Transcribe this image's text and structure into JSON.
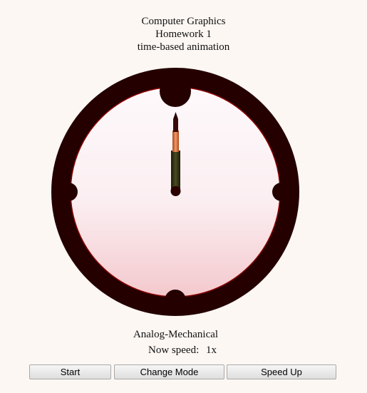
{
  "header": {
    "line1": "Computer Graphics",
    "line2": "Homework 1",
    "line3": "time-based animation"
  },
  "clock": {
    "mode": "Analog-Mechanical",
    "colors": {
      "rim": "#240000",
      "rim_edge": "#7a0000",
      "face_top": "#fdf6f8",
      "face_bottom": "#f5d0d4",
      "hand_dark": "#2e2e12",
      "hand_orange": "#e07a45"
    }
  },
  "status": {
    "speed_label": "Now speed:",
    "speed_value": "1x"
  },
  "controls": {
    "start_label": "Start",
    "change_mode_label": "Change Mode",
    "speed_up_label": "Speed Up"
  }
}
